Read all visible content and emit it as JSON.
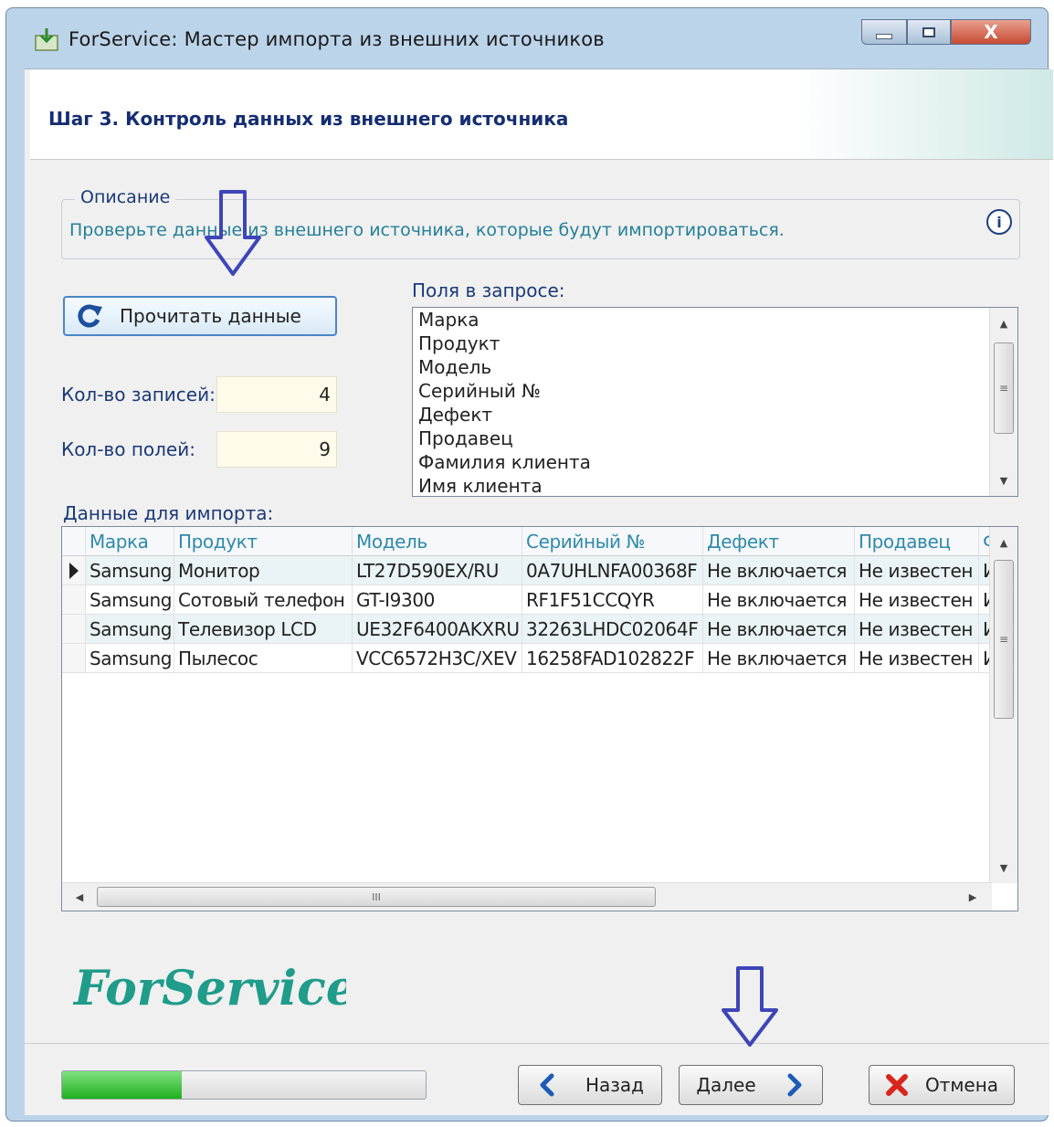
{
  "window": {
    "title": "ForService: Мастер импорта из внешних источников",
    "close_label": "X"
  },
  "header": {
    "step_title": "Шаг 3. Контроль данных из внешнего источника"
  },
  "description": {
    "legend": "Описание",
    "text": "Проверьте данные из внешнего источника, которые будут импортироваться.",
    "info_glyph": "i"
  },
  "read_button": {
    "label": "Прочитать данные"
  },
  "counts": {
    "records_label": "Кол-во записей:",
    "records_value": "4",
    "fields_label": "Кол-во полей:",
    "fields_value": "9"
  },
  "query_fields": {
    "label": "Поля в запросе:",
    "items": [
      "Марка",
      "Продукт",
      "Модель",
      "Серийный №",
      "Дефект",
      "Продавец",
      "Фамилия клиента",
      "Имя клиента"
    ]
  },
  "grid": {
    "label": "Данные для импорта:",
    "columns": [
      "Марка",
      "Продукт",
      "Модель",
      "Серийный №",
      "Дефект",
      "Продавец",
      "Ф"
    ],
    "rows": [
      [
        "Samsung",
        "Монитор",
        "LT27D590EX/RU",
        "0A7UHLNFA00368F",
        "Не включается",
        "Не известен",
        "И"
      ],
      [
        "Samsung",
        "Сотовый телефон",
        "GT-I9300",
        "RF1F51CCQYR",
        "Не включается",
        "Не известен",
        "И"
      ],
      [
        "Samsung",
        "Телевизор LCD",
        "UE32F6400AKXRU",
        "32263LHDC02064F",
        "Не включается",
        "Не известен",
        "И"
      ],
      [
        "Samsung",
        "Пылесос",
        "VCC6572H3C/XEV",
        "16258FAD102822F",
        "Не включается",
        "Не известен",
        "И"
      ]
    ],
    "scroll_glyph": "III"
  },
  "logo_text": "ForService",
  "progress": 0.33,
  "nav": {
    "back_label": "Назад",
    "next_label": "Далее",
    "cancel_label": "Отмена"
  },
  "colors": {
    "accent": "#4a86c8",
    "title_blue": "#152d72",
    "teal_text": "#24809a",
    "annotation_arrow": "#3d45b8",
    "logo": "#1f9c8a",
    "progress": "#20b020",
    "cancel_red": "#d9261c"
  }
}
